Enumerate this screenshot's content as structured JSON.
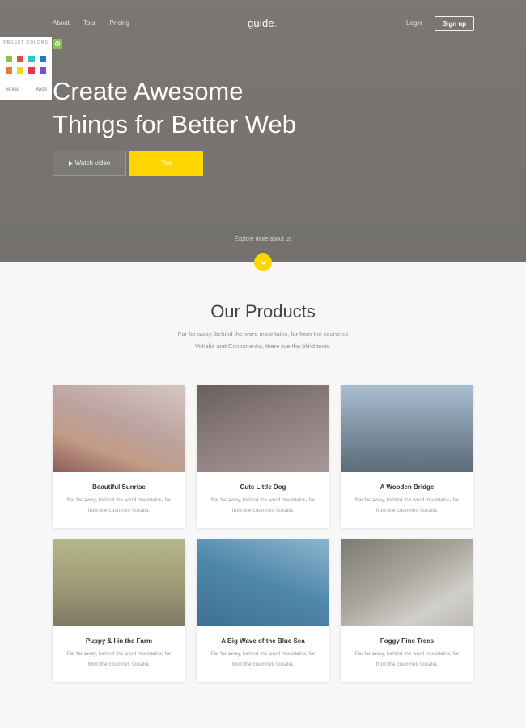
{
  "nav": {
    "links": [
      "About",
      "Tour",
      "Pricing"
    ],
    "logo": "guide",
    "logo_dot": ".",
    "login": "Login",
    "signup": "Sign up"
  },
  "hero": {
    "headline_line1": "Create Awesome",
    "headline_line2": "Things for Better Web",
    "watch_video": "Watch video",
    "yes": "Yes",
    "explore": "Explore more about us"
  },
  "preset": {
    "title": "PRESET COLORS",
    "colors": [
      "#8bc34a",
      "#e74c3c",
      "#2bc6c6",
      "#2f6fc4",
      "#f0743e",
      "#ffd600",
      "#e8344e",
      "#7b4fd6"
    ],
    "layout_boxed": "Boxed",
    "layout_wide": "Wide"
  },
  "products": {
    "title": "Our Products",
    "subtitle_line1": "Far far away, behind the word mountains, far from the countries",
    "subtitle_line2": "Vokalia and Consonantia, there live the blind texts.",
    "items": [
      {
        "title": "Beautiful Sunrise",
        "desc_line1": "Far far away, behind the word mountains, far",
        "desc_line2": "from the countries Vokalia."
      },
      {
        "title": "Cute Little Dog",
        "desc_line1": "Far far away, behind the word mountains, far",
        "desc_line2": "from the countries Vokalia."
      },
      {
        "title": "A Wooden Bridge",
        "desc_line1": "Far far away, behind the word mountains, far",
        "desc_line2": "from the countries Vokalia."
      },
      {
        "title": "Puppy & I in the Farm",
        "desc_line1": "Far far away, behind the word mountains, far",
        "desc_line2": "from the countries Vokalia."
      },
      {
        "title": "A Big Wave of the Blue Sea",
        "desc_line1": "Far far away, behind the word mountains, far",
        "desc_line2": "from the countries Vokalia."
      },
      {
        "title": "Foggy Pine Trees",
        "desc_line1": "Far far away, behind the word mountains, far",
        "desc_line2": "from the countries Vokalia."
      }
    ]
  },
  "colors": {
    "accent": "#ffd600",
    "hero_bg": "#777471",
    "page_bg": "#f7f7f7"
  }
}
